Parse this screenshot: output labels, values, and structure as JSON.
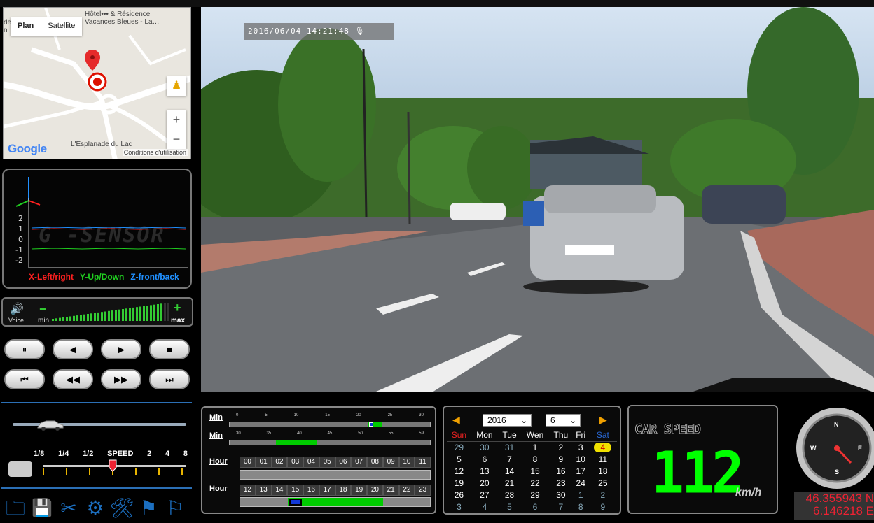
{
  "map": {
    "tabs": [
      "Plan",
      "Satellite"
    ],
    "labels": {
      "hotel": "Hôtel••• & Résidence",
      "hotel2": "Vacances Bleues -  La…",
      "esplanade": "L'Esplanade du Lac",
      "left": "de\nn"
    },
    "google": "Google",
    "terms": "Conditions d'utilisation",
    "zoom_in": "+",
    "zoom_out": "−"
  },
  "gsensor": {
    "watermark": "G -SENSOR",
    "ticks": [
      "2",
      "1",
      "0",
      "-1",
      "-2"
    ],
    "legend": {
      "x": "X-Left/right",
      "y": "Y-Up/Down",
      "z": "Z-front/back"
    },
    "colors": {
      "x": "#ff2020",
      "y": "#20d020",
      "z": "#2090ff"
    }
  },
  "volume": {
    "voice_label": "Voice",
    "min_label": "min",
    "max_label": "max",
    "minus": "−",
    "plus": "+",
    "level": 0.95
  },
  "playback": {
    "row1": [
      "⏸",
      "◀",
      "▶",
      "■"
    ],
    "row2": [
      "⏮",
      "◀◀",
      "▶▶",
      "⏭"
    ]
  },
  "speedctl": {
    "labels": [
      "1/8",
      "1/4",
      "1/2",
      "SPEED",
      "2",
      "4",
      "8"
    ],
    "selected": "SPEED"
  },
  "video": {
    "timestamp": "2016/06/04 14:21:48"
  },
  "timeline": {
    "row_labels": [
      "Min",
      "Min",
      "Hour",
      "Hour"
    ],
    "min_ticks_a": [
      "0",
      "5",
      "10",
      "15",
      "20",
      "25",
      "30"
    ],
    "min_ticks_b": [
      "30",
      "35",
      "40",
      "45",
      "50",
      "55",
      "59"
    ],
    "hours_a": [
      "00",
      "01",
      "02",
      "03",
      "04",
      "05",
      "06",
      "07",
      "08",
      "09",
      "10",
      "11"
    ],
    "hours_b": [
      "12",
      "13",
      "14",
      "15",
      "16",
      "17",
      "18",
      "19",
      "20",
      "21",
      "22",
      "23"
    ]
  },
  "calendar": {
    "year": "2016",
    "month": "6",
    "headers": [
      "Sun",
      "Mon",
      "Tue",
      "Wen",
      "Thu",
      "Fri",
      "Sat"
    ],
    "rows": [
      [
        "29",
        "30",
        "31",
        "1",
        "2",
        "3",
        "4"
      ],
      [
        "5",
        "6",
        "7",
        "8",
        "9",
        "10",
        "11"
      ],
      [
        "12",
        "13",
        "14",
        "15",
        "16",
        "17",
        "18"
      ],
      [
        "19",
        "20",
        "21",
        "22",
        "23",
        "24",
        "25"
      ],
      [
        "26",
        "27",
        "28",
        "29",
        "30",
        "1",
        "2"
      ],
      [
        "3",
        "4",
        "5",
        "6",
        "7",
        "8",
        "9"
      ]
    ],
    "selected_day": "4"
  },
  "speed": {
    "title": "CAR SPEED",
    "value": "112",
    "unit": "km/h"
  },
  "compass": {
    "n": "N",
    "s": "S",
    "e": "E",
    "w": "W"
  },
  "coords": {
    "lat": "46.355943 N",
    "lon": "6.146218 E"
  },
  "toolbar": [
    "folder-icon",
    "save-icon",
    "scissors-icon",
    "gear-icon",
    "tools-icon",
    "flag-icon",
    "flag-pin-icon"
  ]
}
